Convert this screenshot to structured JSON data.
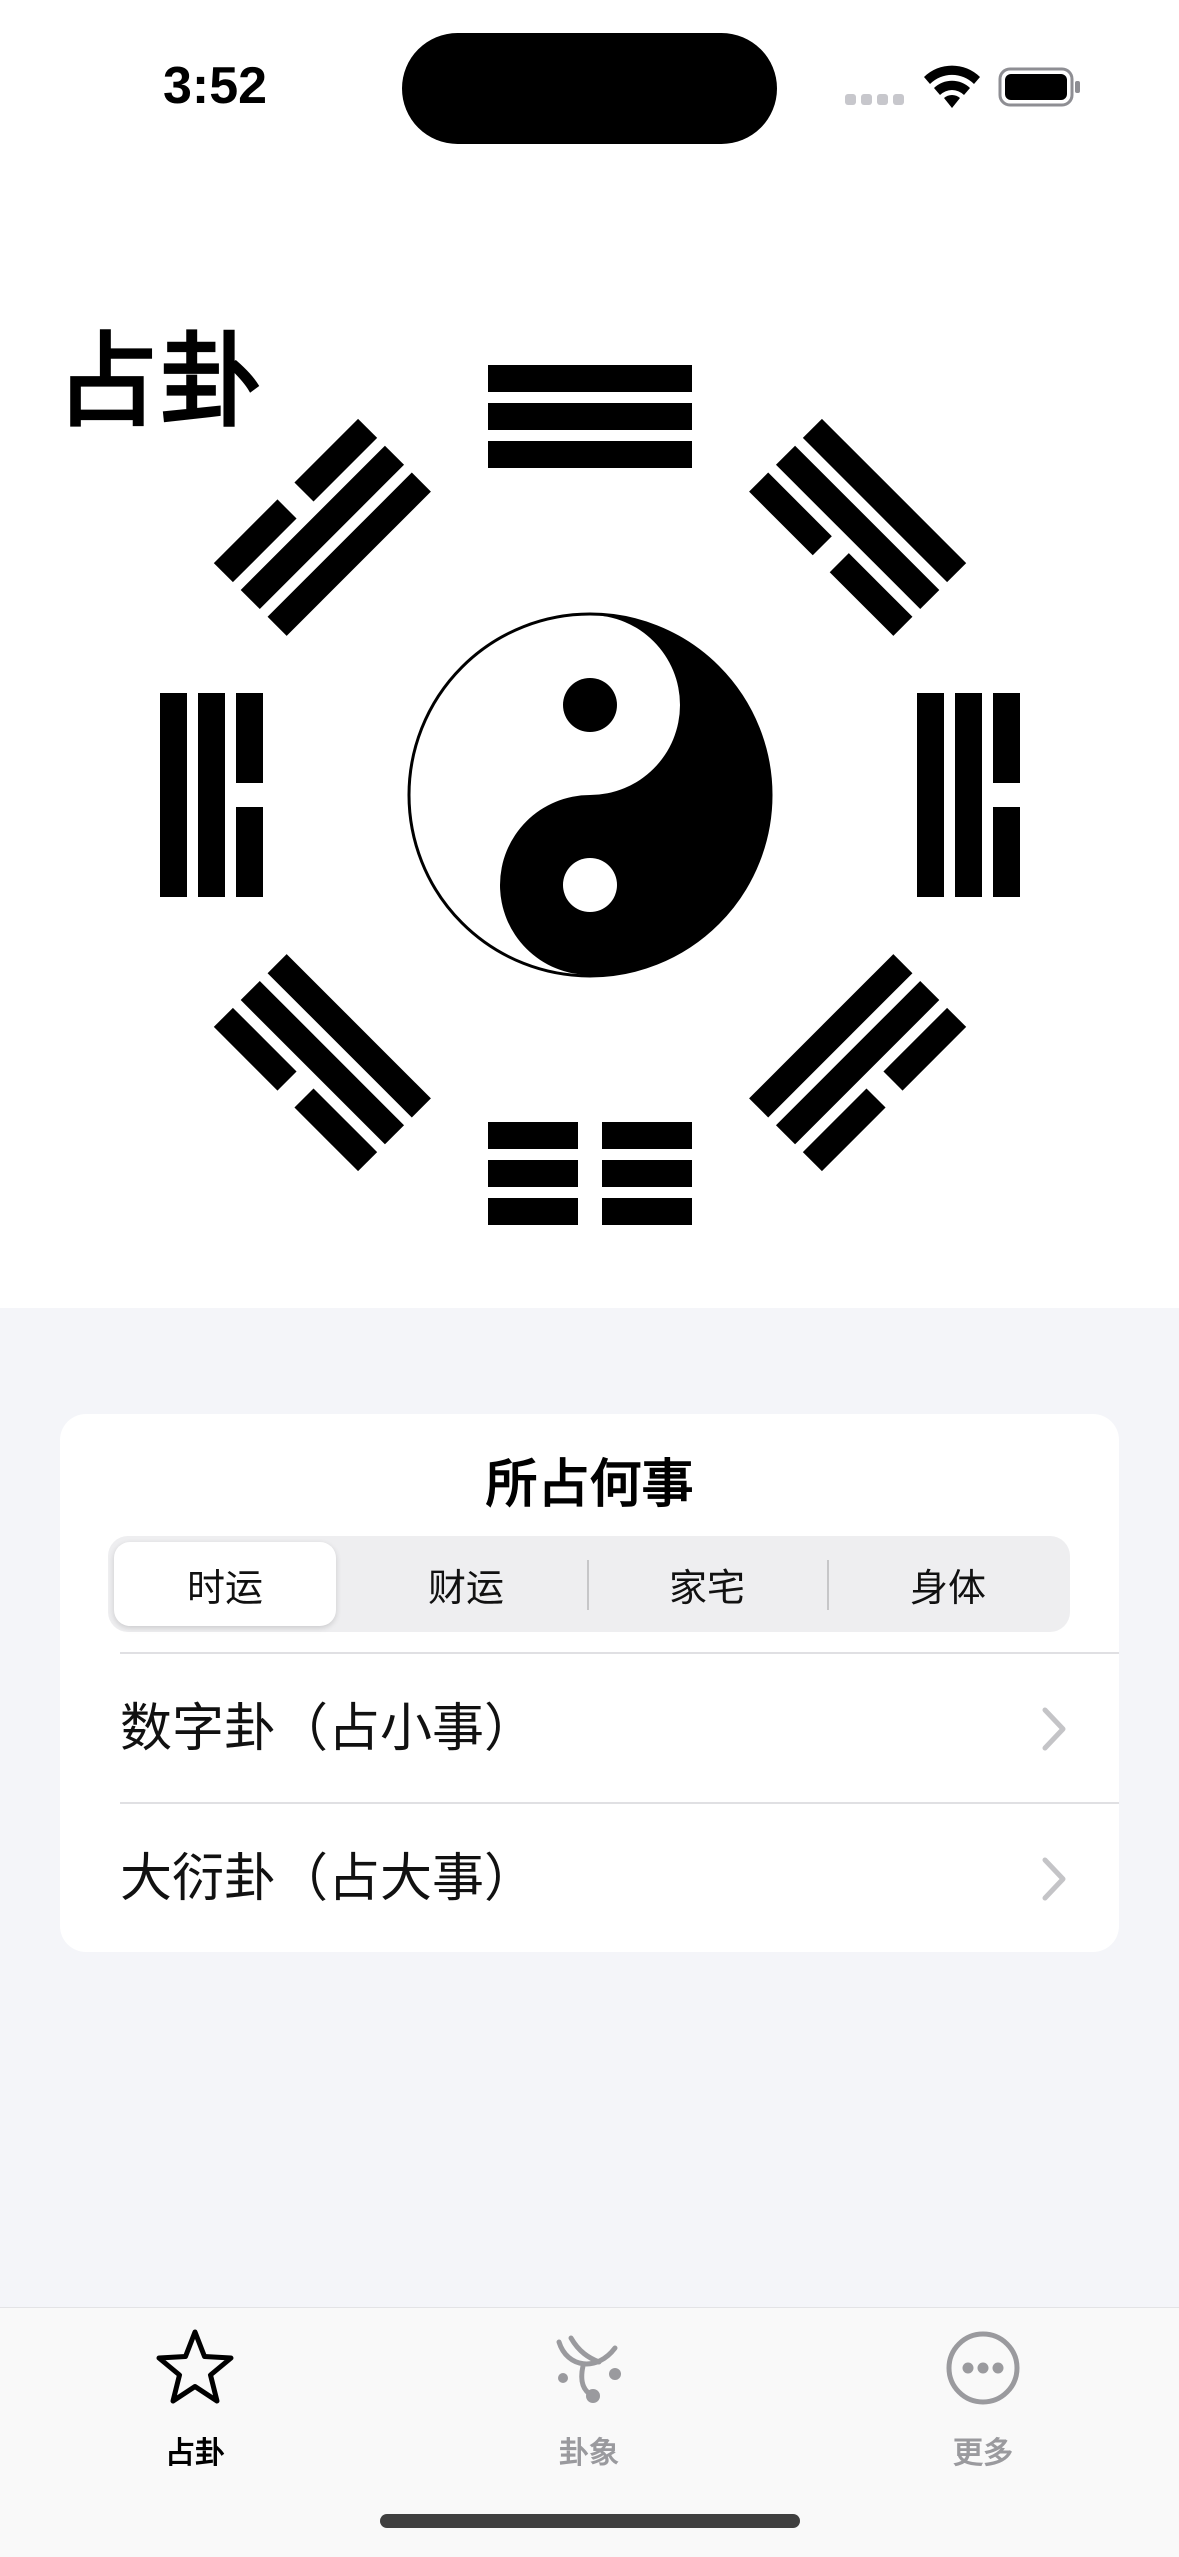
{
  "status_bar": {
    "time": "3:52"
  },
  "header": {
    "title": "占卦"
  },
  "card": {
    "title": "所占何事",
    "segments": [
      "时运",
      "财运",
      "家宅",
      "身体"
    ],
    "selected_segment": "时运",
    "rows": [
      {
        "label": "数字卦（占小事）"
      },
      {
        "label": "大衍卦（占大事）"
      }
    ]
  },
  "tabbar": {
    "items": [
      {
        "label": "占卦",
        "icon": "star-icon",
        "active": true
      },
      {
        "label": "卦象",
        "icon": "hexagram-symbol-icon",
        "active": false
      },
      {
        "label": "更多",
        "icon": "more-ellipsis-icon",
        "active": false
      }
    ]
  },
  "colors": {
    "background": "#f4f5f9",
    "card": "#ffffff",
    "inactive_tab": "#9a9a9e",
    "active_tab": "#000000"
  }
}
